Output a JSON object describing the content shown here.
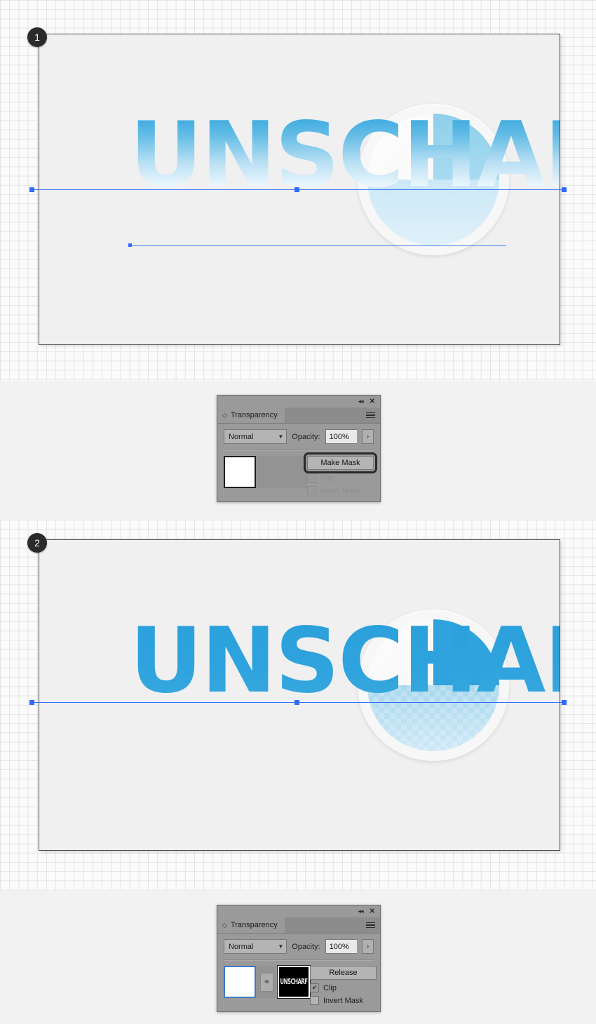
{
  "document": {
    "artwork_word": "UNSCHARF",
    "accent_blue": "#2fa3dd",
    "badge_bg": "#2b2b2b",
    "selection_blue": "#2f6bff"
  },
  "steps": [
    {
      "number": "1",
      "label": "step-1"
    },
    {
      "number": "2",
      "label": "step-2"
    }
  ],
  "panel_step1": {
    "title": "Transparency",
    "collapse_icon": "◂◂",
    "close_icon": "✕",
    "menu_icon": "hamburger-menu",
    "blend_mode": "Normal",
    "opacity_label": "Opacity:",
    "opacity_value": "100%",
    "stepper_icon": "›",
    "action_button": "Make Mask",
    "clip_label": "Clip",
    "clip_checked": false,
    "clip_enabled": false,
    "invert_label": "Invert Mask",
    "invert_checked": false,
    "invert_enabled": false,
    "thumb_alt": "artwork-thumbnail",
    "mask_thumb_text": ""
  },
  "panel_step2": {
    "title": "Transparency",
    "collapse_icon": "◂◂",
    "close_icon": "✕",
    "menu_icon": "hamburger-menu",
    "blend_mode": "Normal",
    "opacity_label": "Opacity:",
    "opacity_value": "100%",
    "stepper_icon": "›",
    "action_button": "Release",
    "clip_label": "Clip",
    "clip_checked": true,
    "clip_enabled": true,
    "invert_label": "Invert Mask",
    "invert_checked": false,
    "invert_enabled": true,
    "link_icon": "⚭",
    "thumb_alt": "artwork-thumbnail",
    "mask_thumb_text": "UNSCHARF",
    "check_glyph": "✔"
  }
}
